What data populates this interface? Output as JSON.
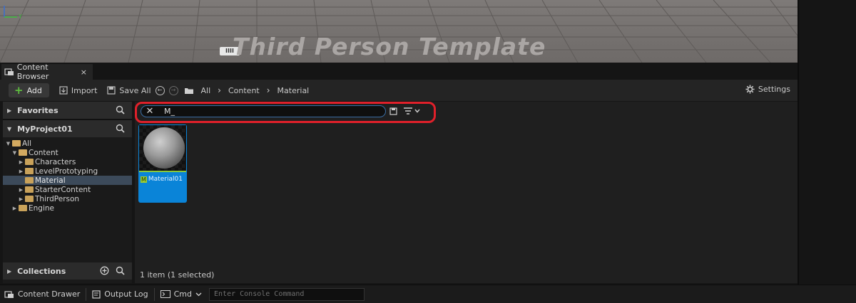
{
  "viewport": {
    "title": "Third Person Template",
    "marker_label": "IIII",
    "axis_label": "Y"
  },
  "tab": {
    "label": "Content Browser",
    "close": "×"
  },
  "toolbar": {
    "add_label": "Add",
    "import_label": "Import",
    "save_all_label": "Save All",
    "breadcrumbs": [
      "All",
      "Content",
      "Material"
    ],
    "settings_label": "Settings"
  },
  "favorites": {
    "label": "Favorites"
  },
  "project": {
    "label": "MyProject01"
  },
  "tree": [
    {
      "label": "All",
      "expanded": true
    },
    {
      "label": "Content",
      "expanded": true
    },
    {
      "label": "Characters"
    },
    {
      "label": "LevelPrototyping"
    },
    {
      "label": "Material",
      "selected": true
    },
    {
      "label": "StarterContent"
    },
    {
      "label": "ThirdPerson"
    },
    {
      "label": "Engine"
    }
  ],
  "collections": {
    "label": "Collections"
  },
  "search": {
    "value": "M_"
  },
  "asset": {
    "badge": "M",
    "name": "Material01"
  },
  "status": "1 item (1 selected)",
  "bottom": {
    "drawer_label": "Content Drawer",
    "output_label": "Output Log",
    "cmd_label": "Cmd",
    "console_placeholder": "Enter Console Command"
  },
  "colors": {
    "accent": "#0a84d8",
    "highlight": "#e0202a",
    "material_line": "#8ac83a"
  }
}
